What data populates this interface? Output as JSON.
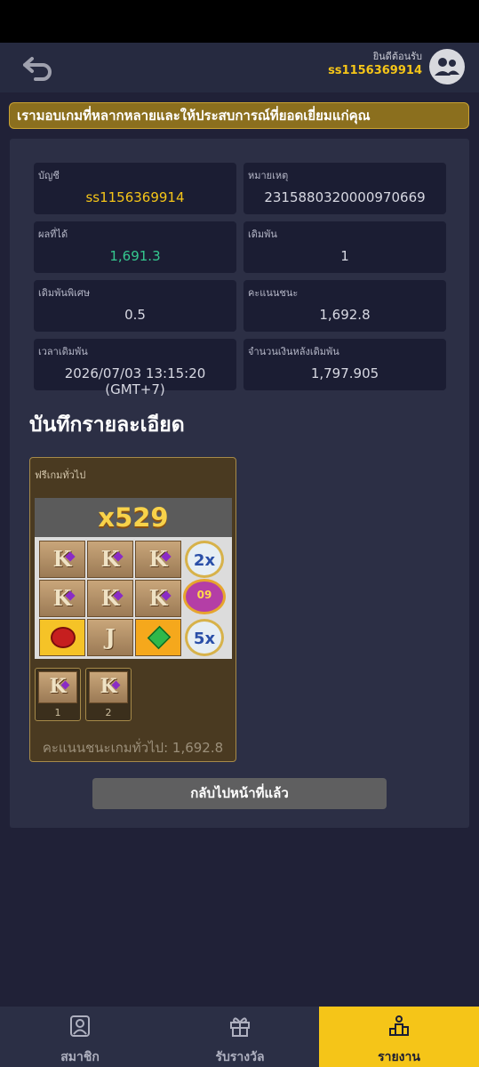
{
  "header": {
    "welcome_label": "ยินดีต้อนรับ",
    "username": "ss1156369914",
    "back_icon": "back-arrow-icon",
    "avatar_icon": "user-avatar-icon"
  },
  "marquee": {
    "text": "เรามอบเกมที่หลากหลายและให้ประสบการณ์ที่ยอดเยี่ยมแก่คุณ"
  },
  "details": {
    "account_label": "บัญชี",
    "account_value": "ss1156369914",
    "note_label": "หมายเหตุ",
    "note_value": "2315880320000970669",
    "result_label": "ผลที่ได้",
    "result_value": "1,691.3",
    "bet_label": "เดิมพัน",
    "bet_value": "1",
    "special_bet_label": "เดิมพันพิเศษ",
    "special_bet_value": "0.5",
    "win_score_label": "คะแนนชนะ",
    "win_score_value": "1,692.8",
    "bet_time_label": "เวลาเดิมพัน",
    "bet_time_value": "2026/07/03 13:15:20 (GMT+7)",
    "balance_after_label": "จำนวนเงินหลังเดิมพัน",
    "balance_after_value": "1,797.905"
  },
  "record": {
    "title": "บันทึกรายละเอียด",
    "card_title": "ฟรีเกมทั่วไป",
    "multiplier": "x529",
    "grid_symbols": [
      "K",
      "K",
      "K",
      "2x",
      "K",
      "K",
      "K",
      "09",
      "red-gem",
      "J",
      "green-gem",
      "5x"
    ],
    "coin_2x": "2x",
    "coin_5x": "5x",
    "coin_purple": "09",
    "small_symbols": [
      {
        "letter": "K",
        "index": "1"
      },
      {
        "letter": "K",
        "index": "2"
      }
    ],
    "total_label": "คะแนนชนะเกมทั่วไป: 1,692.8"
  },
  "back_button": {
    "label": "กลับไปหน้าที่แล้ว"
  },
  "tabs": [
    {
      "label": "สมาชิก",
      "icon": "member-icon",
      "active": false
    },
    {
      "label": "รับรางวัล",
      "icon": "gift-icon",
      "active": false
    },
    {
      "label": "รายงาน",
      "icon": "report-icon",
      "active": true
    }
  ],
  "colors": {
    "accent": "#f5c518",
    "background": "#202137",
    "panel": "#2c2f45",
    "cell": "#1b1d33",
    "green_value": "#35c88f"
  }
}
